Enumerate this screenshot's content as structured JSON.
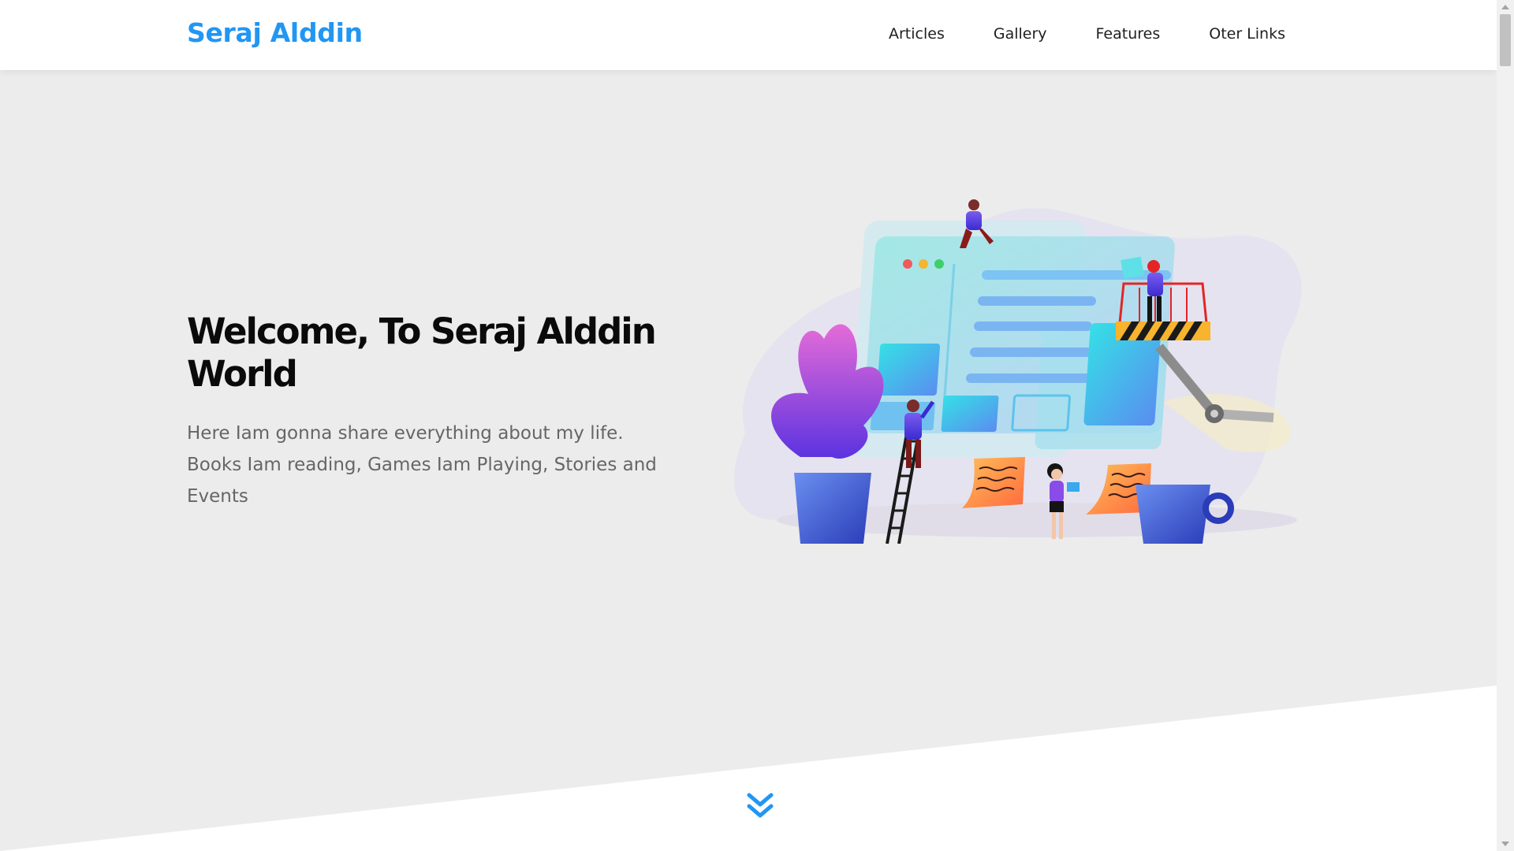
{
  "header": {
    "logo": "Seraj Alddin",
    "nav": [
      "Articles",
      "Gallery",
      "Features",
      "Oter Links"
    ]
  },
  "hero": {
    "title": "Welcome, To Seraj Alddin World",
    "description": "Here Iam gonna share everything about my life. Books Iam reading, Games Iam Playing, Stories and Events"
  },
  "colors": {
    "accent": "#2196f3",
    "hero_bg": "#ececec",
    "title": "#0a0a0a",
    "text": "#666666"
  },
  "icons": {
    "scroll_down": "double-chevron-down-icon"
  }
}
